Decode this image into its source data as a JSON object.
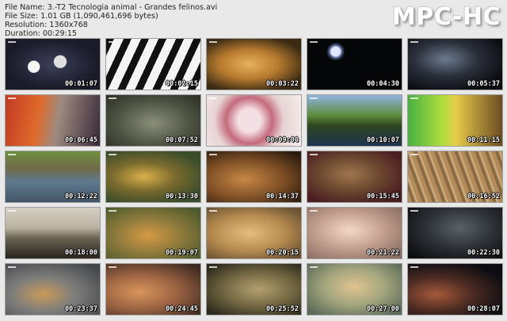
{
  "header": {
    "file_name": "File Name: 3.-T2 Tecnologia animal - Grandes felinos.avi",
    "file_size": "File Size: 1.01 GB (1,090,461,696 bytes)",
    "resolution": "Resolution: 1360x768",
    "duration": "Duration: 00:29:15"
  },
  "logo": "MPC-HC",
  "thumbnails": [
    {
      "time": "00:01:07"
    },
    {
      "time": "00:02:15"
    },
    {
      "time": "00:03:22"
    },
    {
      "time": "00:04:30"
    },
    {
      "time": "00:05:37"
    },
    {
      "time": "00:06:45"
    },
    {
      "time": "00:07:52"
    },
    {
      "time": "00:09:00"
    },
    {
      "time": "00:10:07"
    },
    {
      "time": "00:11:15"
    },
    {
      "time": "00:12:22"
    },
    {
      "time": "00:13:30"
    },
    {
      "time": "00:14:37"
    },
    {
      "time": "00:15:45"
    },
    {
      "time": "00:16:52"
    },
    {
      "time": "00:18:00"
    },
    {
      "time": "00:19:07"
    },
    {
      "time": "00:20:15"
    },
    {
      "time": "00:21:22"
    },
    {
      "time": "00:22:30"
    },
    {
      "time": "00:23:37"
    },
    {
      "time": "00:24:45"
    },
    {
      "time": "00:25:52"
    },
    {
      "time": "00:27:00"
    },
    {
      "time": "00:28:07"
    }
  ]
}
